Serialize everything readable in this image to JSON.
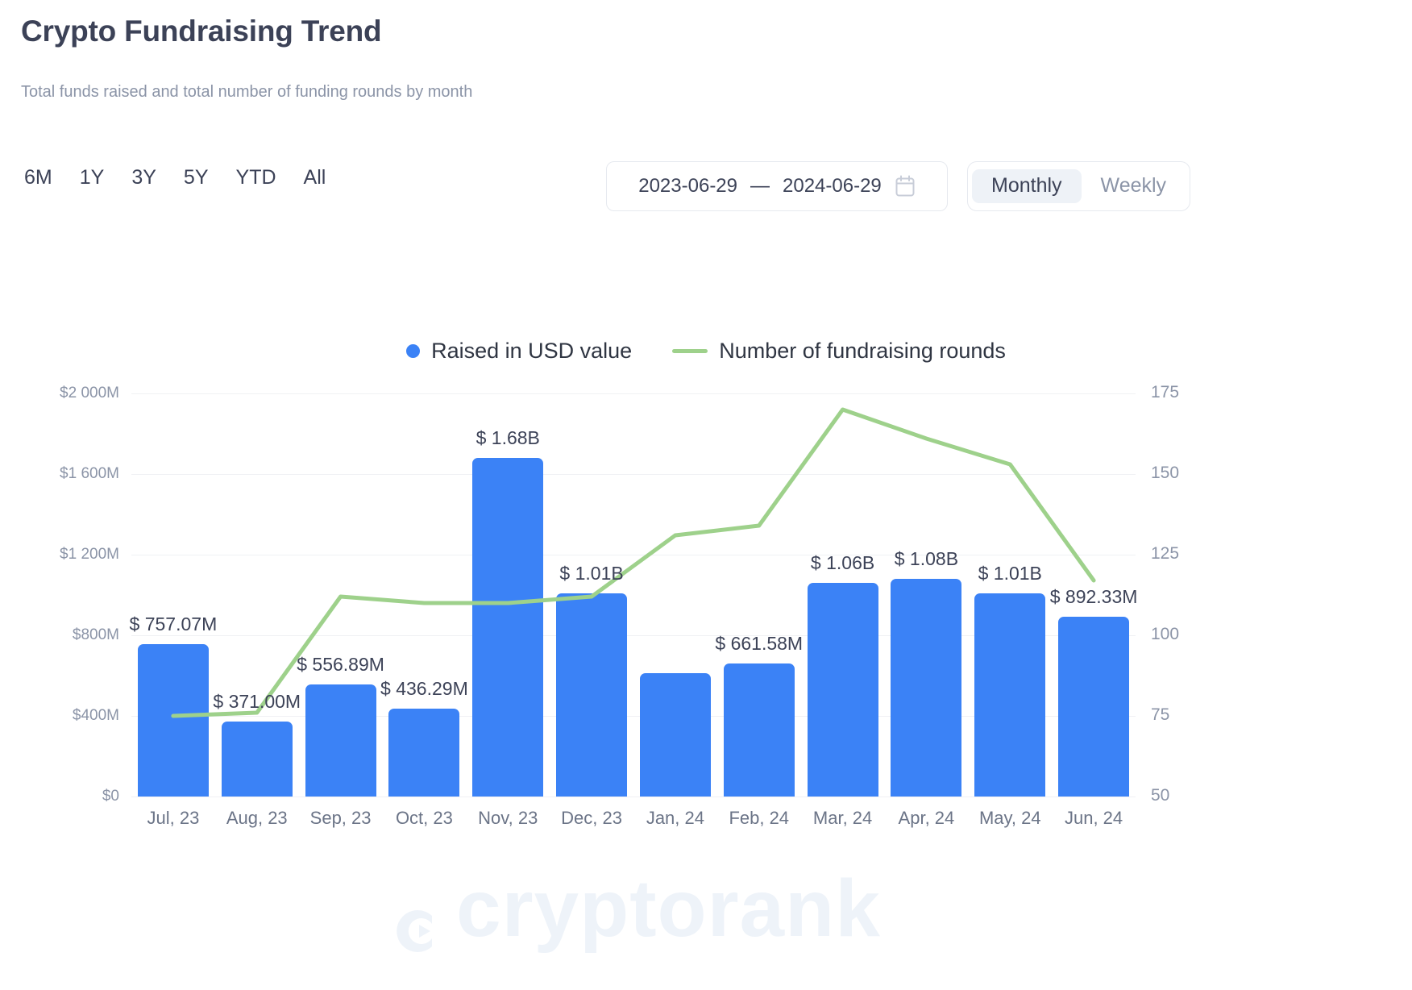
{
  "header": {
    "title": "Crypto Fundraising Trend",
    "subtitle": "Total funds raised and total number of funding rounds by month"
  },
  "controls": {
    "ranges": [
      "6M",
      "1Y",
      "3Y",
      "5Y",
      "YTD",
      "All"
    ],
    "date_range": {
      "start": "2023-06-29",
      "separator": "—",
      "end": "2024-06-29"
    },
    "calendar_icon": "calendar-icon",
    "interval_toggle": {
      "options": [
        "Monthly",
        "Weekly"
      ],
      "selected": "Monthly"
    }
  },
  "watermark": "cryptorank",
  "chart_data": {
    "type": "bar",
    "title": "Crypto Fundraising Trend",
    "subtitle": "Total funds raised and total number of funding rounds by month",
    "xlabel": "",
    "ylabel": "Raised in USD value",
    "y2label": "Number of fundraising rounds",
    "grid": true,
    "legend_position": "top-center",
    "colors": {
      "bar": "#3b82f6",
      "line": "#9ed18b"
    },
    "categories": [
      "Jul, 23",
      "Aug, 23",
      "Sep, 23",
      "Oct, 23",
      "Nov, 23",
      "Dec, 23",
      "Jan, 24",
      "Feb, 24",
      "Mar, 24",
      "Apr, 24",
      "May, 24",
      "Jun, 24"
    ],
    "ylim": [
      0,
      2000
    ],
    "y_ticks": [
      0,
      400,
      800,
      1200,
      1600,
      2000
    ],
    "y_tick_labels": [
      "$0",
      "$400M",
      "$800M",
      "$1 200M",
      "$1 600M",
      "$2 000M"
    ],
    "y2lim": [
      50,
      175
    ],
    "y2_ticks": [
      50,
      75,
      100,
      125,
      150,
      175
    ],
    "y2_tick_labels": [
      "50",
      "75",
      "100",
      "125",
      "150",
      "175"
    ],
    "series": [
      {
        "name": "Raised in USD value",
        "type": "bar",
        "axis": "left",
        "unit": "USD millions",
        "values": [
          757.07,
          371.0,
          556.89,
          436.29,
          1680,
          1010,
          611,
          661.58,
          1060,
          1080,
          1010,
          892.33
        ],
        "data_labels": [
          "$ 757.07M",
          "$ 371.00M",
          "$ 556.89M",
          "$ 436.29M",
          "$ 1.68B",
          "$ 1.01B",
          "",
          "$ 661.58M",
          "$ 1.06B",
          "$ 1.08B",
          "$ 1.01B",
          "$ 892.33M"
        ]
      },
      {
        "name": "Number of fundraising rounds",
        "type": "line",
        "axis": "right",
        "values": [
          75,
          76,
          112,
          110,
          110,
          112,
          131,
          134,
          170,
          161,
          153,
          117
        ]
      }
    ]
  }
}
